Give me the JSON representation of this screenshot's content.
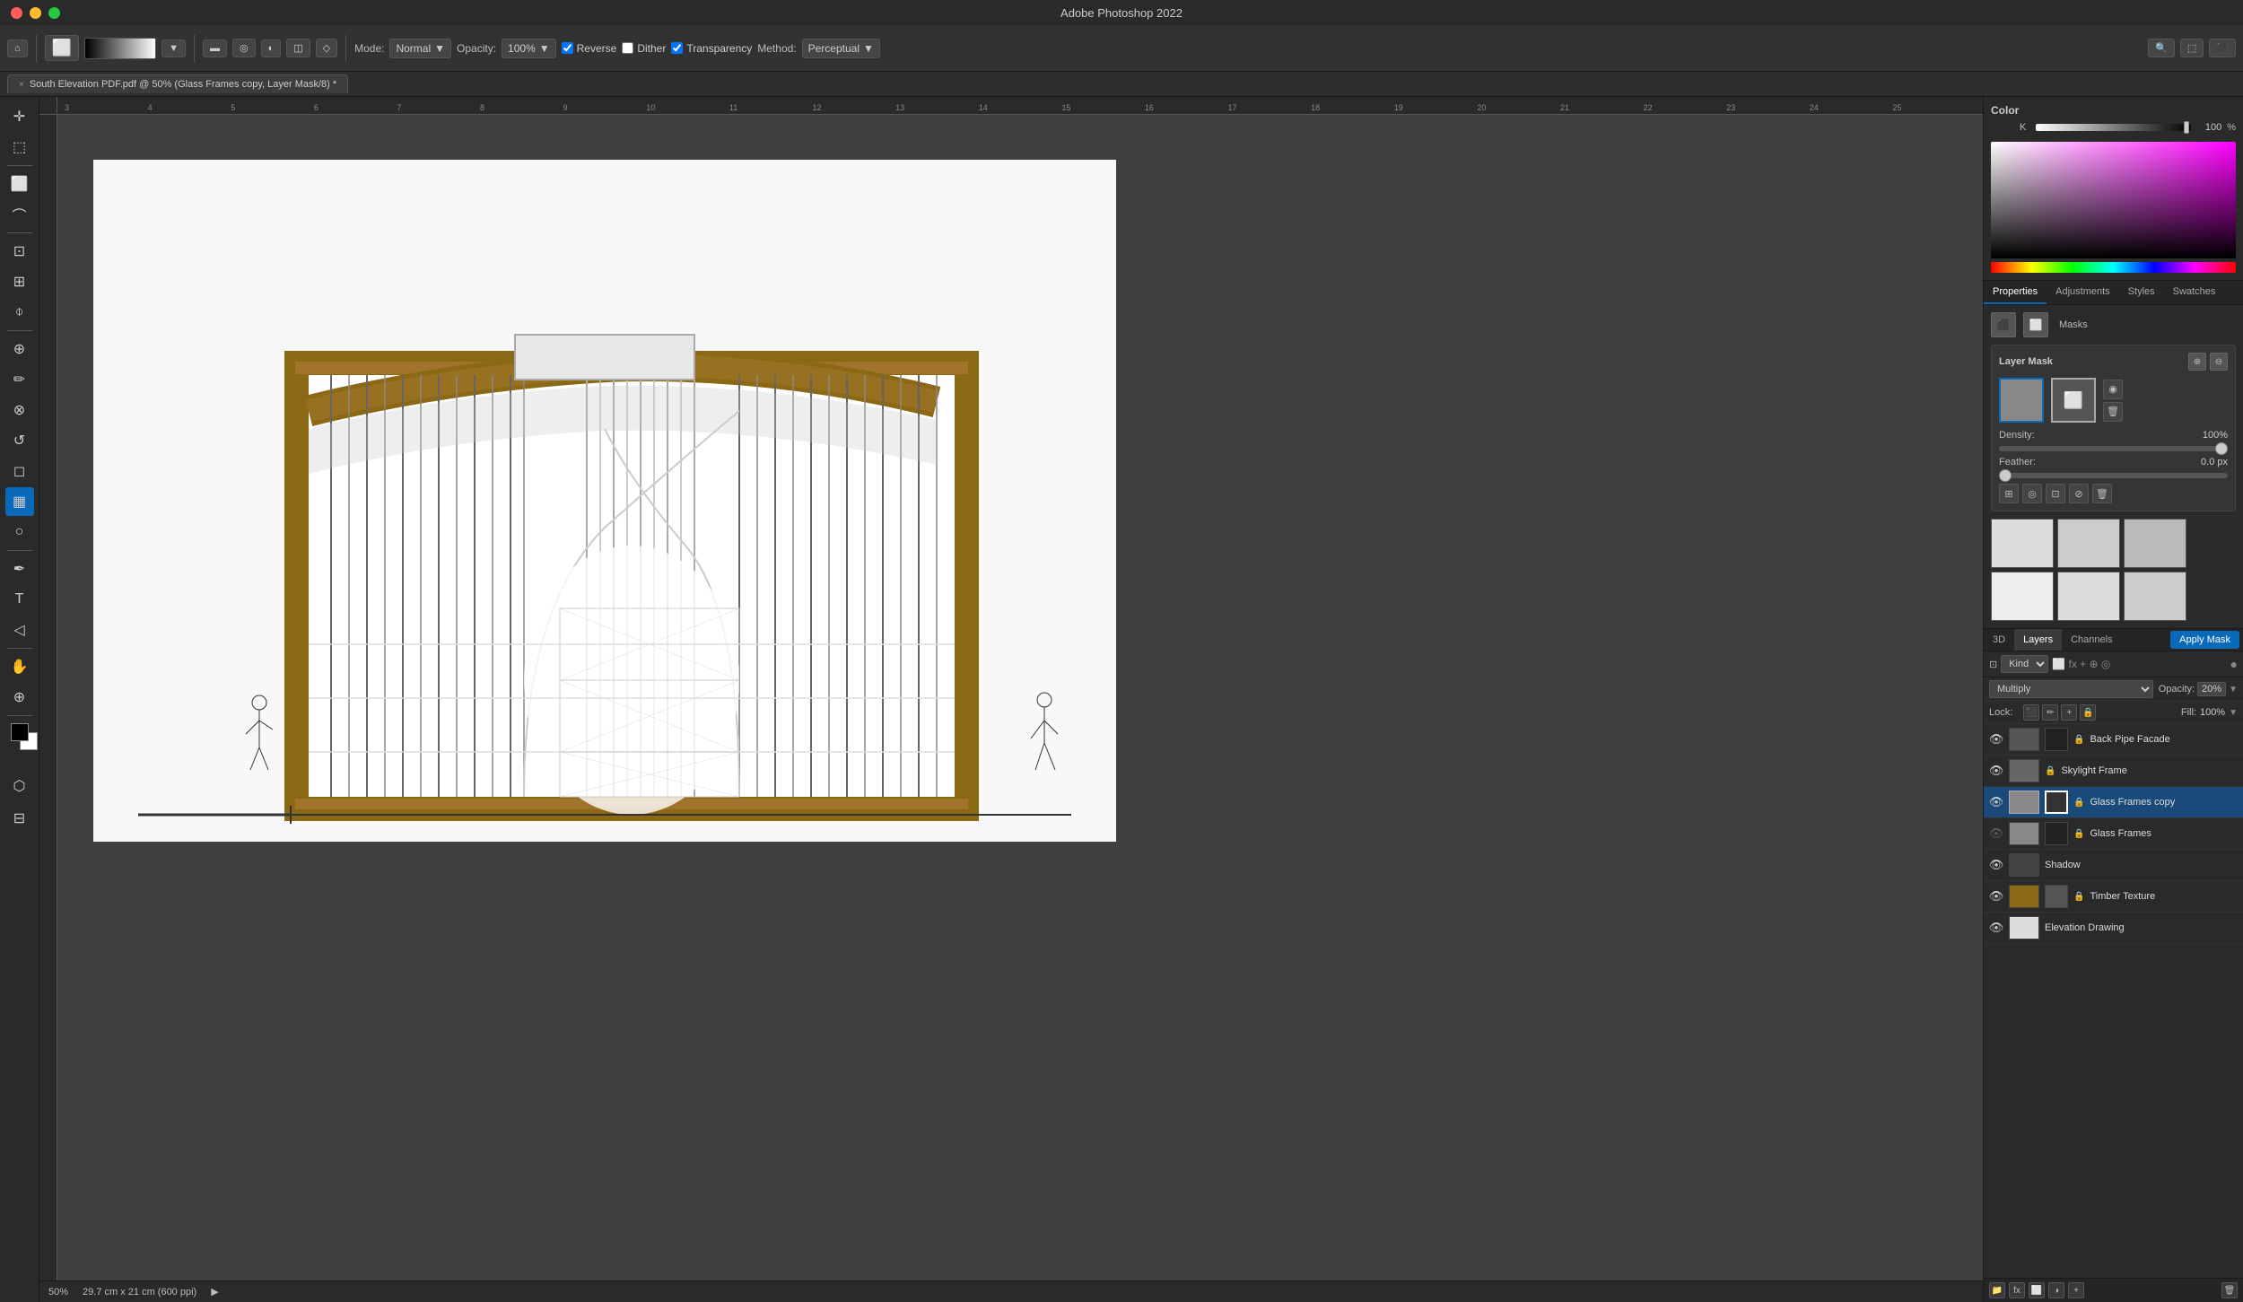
{
  "app": {
    "title": "Adobe Photoshop 2022",
    "window_controls": [
      "close",
      "minimize",
      "maximize"
    ]
  },
  "tab": {
    "close_label": "×",
    "title": "South Elevation PDF.pdf @ 50% (Glass Frames copy, Layer Mask/8) *"
  },
  "toolbar": {
    "mode_label": "Mode:",
    "mode_value": "Normal",
    "opacity_label": "Opacity:",
    "opacity_value": "100%",
    "reverse_label": "Reverse",
    "dither_label": "Dither",
    "transparency_label": "Transparency",
    "method_label": "Method:",
    "method_value": "Perceptual"
  },
  "color_panel": {
    "title": "Color",
    "k_label": "K",
    "k_value": "100",
    "k_pct": "%"
  },
  "properties_panel": {
    "tabs": [
      "Properties",
      "Adjustments",
      "Styles",
      "Swatches"
    ],
    "masks_title": "Masks",
    "layer_mask_title": "Layer Mask",
    "density_label": "Density:",
    "density_value": "100%",
    "feather_label": "Feather:",
    "feather_value": "0.0 px"
  },
  "layers_panel": {
    "tabs": [
      "3D",
      "Layers",
      "Channels"
    ],
    "apply_mask_btn": "Apply Mask",
    "filter_label": "Kind",
    "blend_mode": "Multiply",
    "opacity_label": "Opacity:",
    "opacity_value": "20%",
    "lock_label": "Lock:",
    "fill_label": "Fill:",
    "fill_value": "100%",
    "layers": [
      {
        "name": "Back Pipe Facade",
        "visible": true,
        "selected": false,
        "has_mask": true
      },
      {
        "name": "Skylight Frame",
        "visible": true,
        "selected": false,
        "has_mask": false
      },
      {
        "name": "Glass Frames copy",
        "visible": true,
        "selected": true,
        "has_mask": true
      },
      {
        "name": "Glass Frames",
        "visible": false,
        "selected": false,
        "has_mask": true
      },
      {
        "name": "Shadow",
        "visible": true,
        "selected": false,
        "has_mask": false
      },
      {
        "name": "Timber Texture",
        "visible": true,
        "selected": false,
        "has_mask": true
      },
      {
        "name": "Elevation Drawing",
        "visible": true,
        "selected": false,
        "has_mask": false
      }
    ]
  },
  "status_bar": {
    "zoom": "50%",
    "dimensions": "29.7 cm x 21 cm (600 ppi)"
  }
}
